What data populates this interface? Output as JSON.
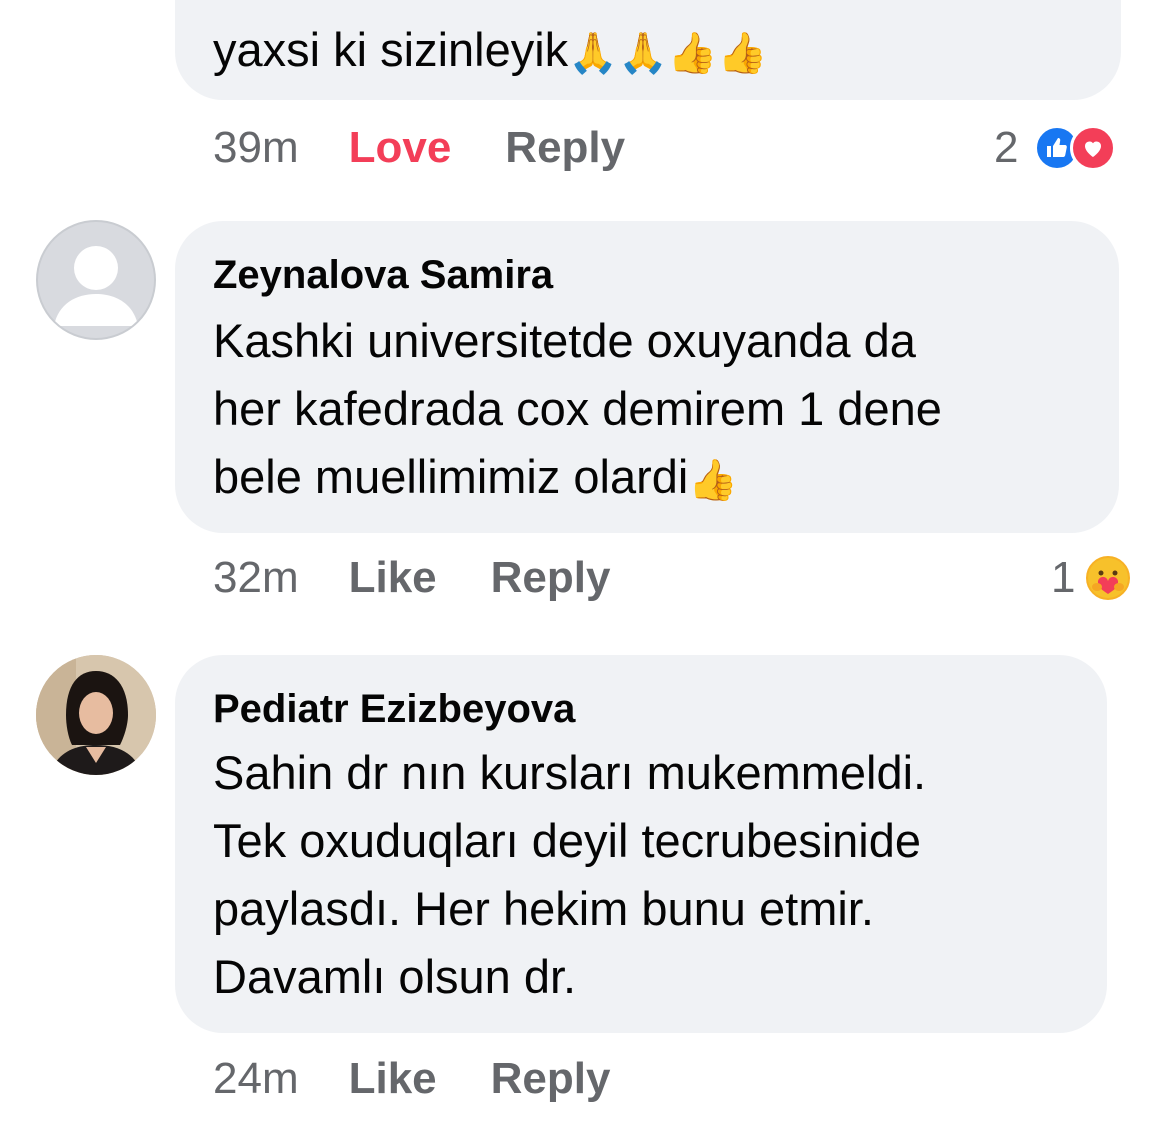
{
  "comments": [
    {
      "author": "",
      "text_lines": [
        "yaxsi ki sizinleyik"
      ],
      "emoji": "🙏🙏👍👍",
      "time": "39m",
      "action_like": "Love",
      "action_reply": "Reply",
      "reaction_count": "2",
      "reaction_icons": [
        "like-icon",
        "heart-icon"
      ]
    },
    {
      "author": "Zeynalova Samira",
      "text_lines": [
        "Kashki universitetde oxuyanda da",
        "her kafedrada cox demirem 1 dene",
        "bele muellimimiz olardi"
      ],
      "emoji": "👍",
      "time": "32m",
      "action_like": "Like",
      "action_reply": "Reply",
      "reaction_count": "1",
      "reaction_icons": [
        "care-icon"
      ]
    },
    {
      "author": "Pediatr Ezizbeyova",
      "text_lines": [
        "Sahin dr nın kursları mukemmeldi.",
        "Tek oxuduqları deyil tecrubesinide",
        "paylasdı. Her hekim bunu etmir.",
        "Davamlı olsun dr."
      ],
      "time": "24m",
      "action_like": "Like",
      "action_reply": "Reply"
    }
  ],
  "colors": {
    "bubble": "#f0f2f5",
    "meta": "#65676b",
    "love": "#f33e58",
    "like_blue": "#1877f2"
  }
}
